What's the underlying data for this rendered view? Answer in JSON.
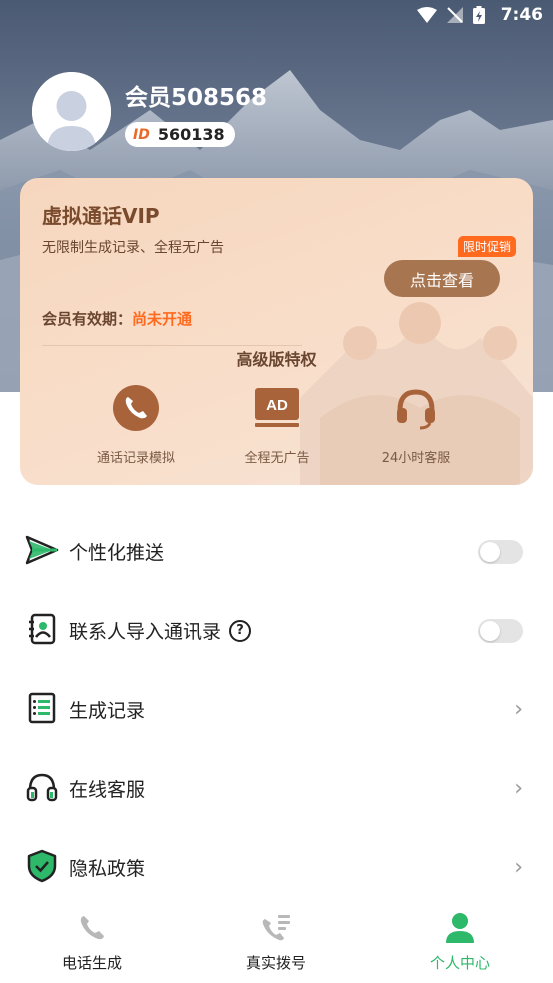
{
  "status_bar": {
    "time": "7:46"
  },
  "profile": {
    "username": "会员508568",
    "id_tag": "ID",
    "id_number": "560138"
  },
  "vip_card": {
    "title": "虚拟通话VIP",
    "subtitle": "无限制生成记录、全程无广告",
    "promo_badge": "限时促销",
    "check_button": "点击查看",
    "expire_label": "会员有效期：",
    "expire_value": "尚未开通",
    "privileges_title": "高级版特权",
    "privileges": [
      {
        "label": "通话记录模拟",
        "icon": "phone-icon"
      },
      {
        "label": "全程无广告",
        "icon": "ad-icon",
        "icon_text": "AD"
      },
      {
        "label": "24小时客服",
        "icon": "headset-icon"
      }
    ],
    "colors": {
      "accent_brown": "#a87551",
      "promo_orange": "#ff6a1f"
    }
  },
  "settings": [
    {
      "label": "个性化推送",
      "icon": "send-icon",
      "control": "toggle",
      "on": false
    },
    {
      "label": "联系人导入通讯录",
      "icon": "contacts-icon",
      "control": "toggle",
      "on": false,
      "help": "?"
    },
    {
      "label": "生成记录",
      "icon": "records-icon",
      "control": "chevron"
    },
    {
      "label": "在线客服",
      "icon": "headset-icon",
      "control": "chevron"
    },
    {
      "label": "隐私政策",
      "icon": "shield-check-icon",
      "control": "chevron"
    }
  ],
  "bottom_nav": {
    "items": [
      {
        "label": "电话生成",
        "icon": "phone-icon",
        "active": false
      },
      {
        "label": "真实拨号",
        "icon": "dialpad-phone-icon",
        "active": false
      },
      {
        "label": "个人中心",
        "icon": "person-icon",
        "active": true
      }
    ],
    "active_color": "#2db86a"
  }
}
